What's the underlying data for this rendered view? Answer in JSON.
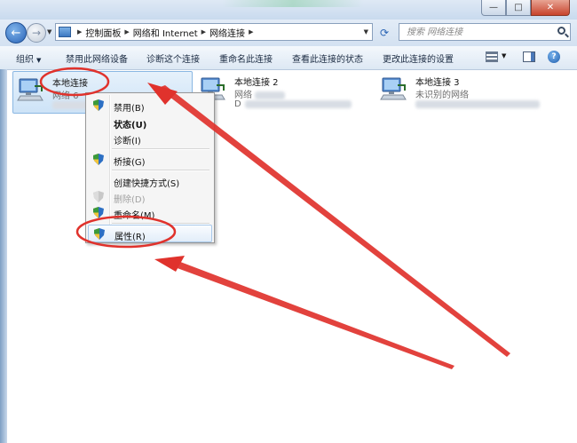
{
  "window": {
    "minimize_glyph": "—",
    "maximize_glyph": "□",
    "close_glyph": "✕"
  },
  "nav": {
    "back_glyph": "←",
    "forward_glyph": "→",
    "breadcrumb": [
      "控制面板",
      "网络和 Internet",
      "网络连接"
    ],
    "search_placeholder": "搜索 网络连接",
    "refresh_icon": "refresh-icon",
    "search_icon": "search-icon"
  },
  "toolbar": {
    "organize": "组织",
    "disable": "禁用此网络设备",
    "diagnose": "诊断这个连接",
    "rename": "重命名此连接",
    "view_status": "查看此连接的状态",
    "change_settings": "更改此连接的设置",
    "help_glyph": "?"
  },
  "connections": [
    {
      "name": "本地连接",
      "network": "网络 6",
      "selected": true
    },
    {
      "name": "本地连接 2",
      "network": "网络",
      "device_prefix": "D",
      "selected": false
    },
    {
      "name": "本地连接 3",
      "network": "未识别的网络",
      "selected": false
    }
  ],
  "context_menu": {
    "items": [
      {
        "label": "禁用(B)",
        "shield": true
      },
      {
        "label": "状态(U)",
        "bold": true
      },
      {
        "label": "诊断(I)"
      },
      {
        "label": "桥接(G)",
        "shield": true
      },
      {
        "label": "创建快捷方式(S)"
      },
      {
        "label": "删除(D)",
        "shield": true,
        "disabled": true
      },
      {
        "label": "重命名(M)",
        "shield": true
      },
      {
        "label": "属性(R)",
        "shield": true,
        "highlighted": true
      }
    ]
  },
  "annotation": {
    "color": "#e0322c"
  }
}
